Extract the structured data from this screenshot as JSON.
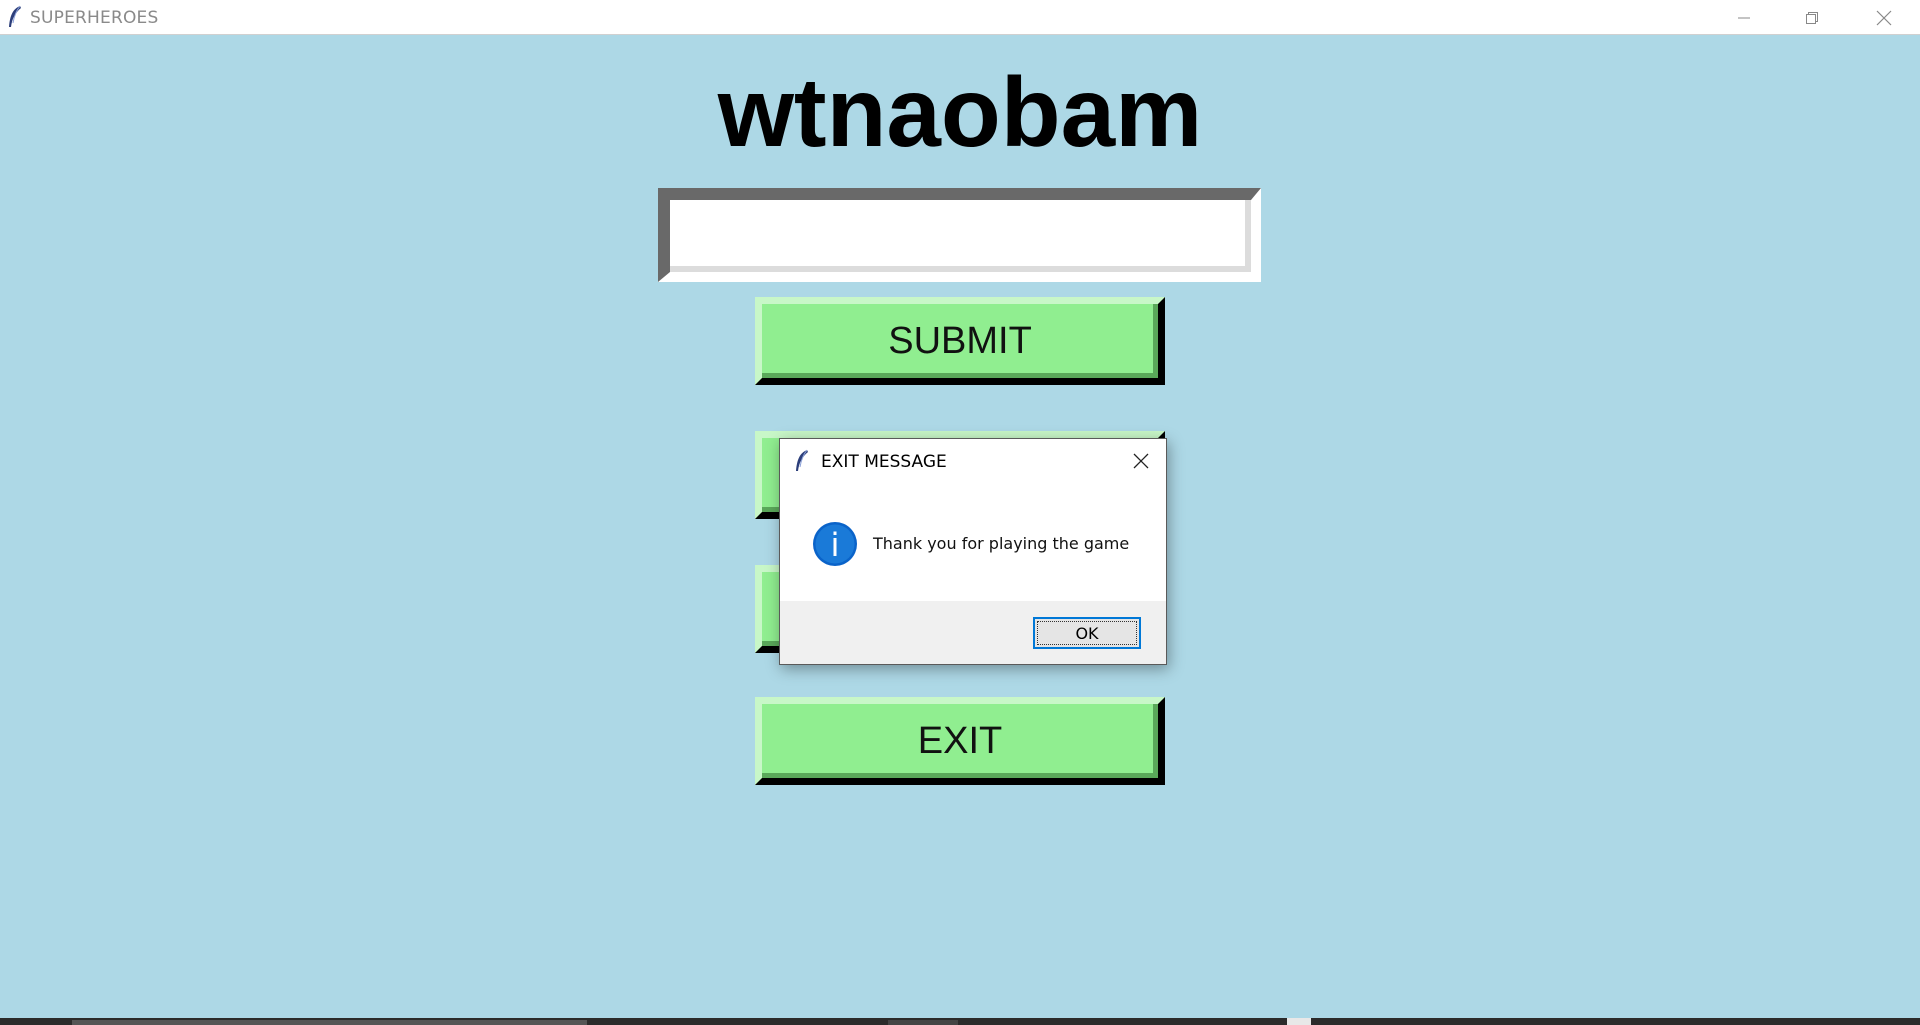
{
  "window": {
    "title": "SUPERHEROES",
    "icon": "feather-icon",
    "controls": [
      "minimize-icon",
      "restore-icon",
      "close-icon"
    ]
  },
  "main": {
    "scrambled_word": "wtnaobam",
    "answer_input": {
      "value": "",
      "placeholder": ""
    },
    "submit_label": "SUBMIT",
    "exit_label": "EXIT"
  },
  "dialog": {
    "title": "EXIT MESSAGE",
    "icon": "info-icon",
    "message": "Thank you for playing the game",
    "ok_label": "OK"
  },
  "colors": {
    "background": "#add8e6",
    "button": "#90ee90",
    "dialog_accent": "#0078d7"
  }
}
